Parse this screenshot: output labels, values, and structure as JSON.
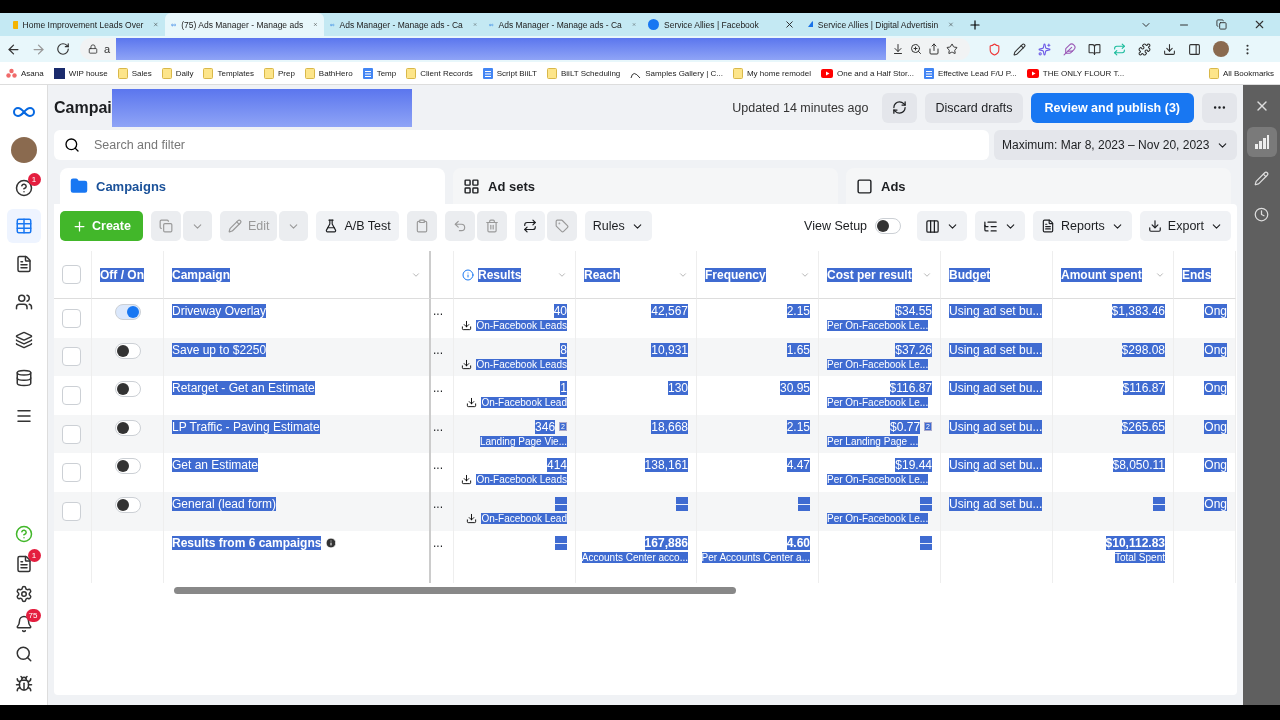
{
  "browser": {
    "tabs": [
      {
        "title": "Home Improvement Leads Over",
        "kind": "sheet",
        "selected": false
      },
      {
        "title": "(75) Ads Manager - Manage ads",
        "kind": "meta",
        "selected": true
      },
      {
        "title": "Ads Manager - Manage ads - Ca",
        "kind": "meta",
        "selected": false
      },
      {
        "title": "Ads Manager - Manage ads - Ca",
        "kind": "meta",
        "selected": false
      },
      {
        "title": "Service Allies | Facebook",
        "kind": "facebook",
        "selected": false
      },
      {
        "title": "Service Allies | Digital Advertisin",
        "kind": "site",
        "selected": false
      }
    ],
    "address": {
      "text": "a",
      "redacted": true
    },
    "bookmarks": [
      {
        "label": "Asana",
        "kind": "asana"
      },
      {
        "label": "WIP house",
        "kind": "logo"
      },
      {
        "label": "Sales",
        "kind": "folder"
      },
      {
        "label": "Daily",
        "kind": "folder"
      },
      {
        "label": "Templates",
        "kind": "folder"
      },
      {
        "label": "Prep",
        "kind": "folder"
      },
      {
        "label": "BathHero",
        "kind": "folder"
      },
      {
        "label": "Temp",
        "kind": "doc"
      },
      {
        "label": "Client Records",
        "kind": "folder"
      },
      {
        "label": "Script BiiLT",
        "kind": "doc"
      },
      {
        "label": "BiiLT Scheduling",
        "kind": "folder"
      },
      {
        "label": "Samples Gallery | C...",
        "kind": "arc"
      },
      {
        "label": "My home remodel",
        "kind": "folder"
      },
      {
        "label": "One and a Half Stor...",
        "kind": "video"
      },
      {
        "label": "Effective Lead F/U P...",
        "kind": "doc"
      },
      {
        "label": "THE ONLY FLOUR T...",
        "kind": "video"
      }
    ],
    "all_bookmarks": "All Bookmarks"
  },
  "nav_rail": {
    "items": [
      {
        "kind": "logo",
        "selected": false
      },
      {
        "kind": "avatar",
        "selected": false
      },
      {
        "kind": "alerts",
        "selected": false,
        "badge": "1"
      },
      {
        "kind": "table",
        "selected": true
      },
      {
        "kind": "pages",
        "selected": false
      },
      {
        "kind": "audience",
        "selected": false
      },
      {
        "kind": "catalog",
        "selected": false
      },
      {
        "kind": "database",
        "selected": false
      },
      {
        "kind": "menu",
        "selected": false
      }
    ],
    "bottom_items": [
      {
        "kind": "help",
        "selected": false
      },
      {
        "kind": "pages",
        "selected": false,
        "badge": "1"
      },
      {
        "kind": "settings",
        "selected": false
      },
      {
        "kind": "bell",
        "selected": false,
        "badge": "75"
      },
      {
        "kind": "search",
        "selected": false
      },
      {
        "kind": "bug",
        "selected": false
      }
    ]
  },
  "header": {
    "title": "Campai",
    "title_redacted": true,
    "updated": "Updated 14 minutes ago",
    "discard": "Discard drafts",
    "publish": "Review and publish (3)"
  },
  "search": {
    "placeholder": "Search and filter"
  },
  "date_range": "Maximum: Mar 8, 2023 – Nov 20, 2023",
  "level_tabs": [
    {
      "label": "Campaigns",
      "kind": "campaigns",
      "selected": true
    },
    {
      "label": "Ad sets",
      "kind": "adsets",
      "selected": false
    },
    {
      "label": "Ads",
      "kind": "ads",
      "selected": false
    }
  ],
  "toolbar": {
    "create": "Create",
    "edit": "Edit",
    "ab_test": "A/B Test",
    "rules": "Rules",
    "view_setup": {
      "label": "View Setup",
      "on": false
    },
    "reports": "Reports",
    "export": "Export"
  },
  "table": {
    "text_selected": true,
    "all_checked": false,
    "columns": [
      {
        "label": "Off / On",
        "sortable": false
      },
      {
        "label": "Campaign",
        "sortable": true
      },
      {
        "label": "Results",
        "sortable": true
      },
      {
        "label": "Reach",
        "sortable": true
      },
      {
        "label": "Frequency",
        "sortable": true
      },
      {
        "label": "Cost per result",
        "sortable": true
      },
      {
        "label": "Budget",
        "sortable": false
      },
      {
        "label": "Amount spent",
        "sortable": true
      },
      {
        "label": "Ends",
        "sortable": false
      }
    ],
    "rows": [
      {
        "checked": false,
        "on": true,
        "name": "Driveway Overlay",
        "delivery": "...",
        "results": {
          "value": "40",
          "label": "On-Facebook Leads",
          "download": true
        },
        "reach": "42,567",
        "frequency": "2.15",
        "cost": {
          "value": "$34.55",
          "label": "Per On-Facebook Le..."
        },
        "budget": "Using ad set bu...",
        "spent": "$1,383.46",
        "ends": "Ong"
      },
      {
        "checked": false,
        "on": false,
        "name": "Save up to $2250",
        "delivery": "...",
        "results": {
          "value": "8",
          "label": "On-Facebook Leads",
          "download": true
        },
        "reach": "10,931",
        "frequency": "1.65",
        "cost": {
          "value": "$37.26",
          "label": "Per On-Facebook Le..."
        },
        "budget": "Using ad set bu...",
        "spent": "$298.08",
        "ends": "Ong"
      },
      {
        "checked": false,
        "on": false,
        "name": "Retarget - Get an Estimate",
        "delivery": "...",
        "results": {
          "value": "1",
          "label": "On-Facebook Lead",
          "download": true
        },
        "reach": "130",
        "frequency": "30.95",
        "cost": {
          "value": "$116.87",
          "label": "Per On-Facebook Le..."
        },
        "budget": "Using ad set bu...",
        "spent": "$116.87",
        "ends": "Ong"
      },
      {
        "checked": false,
        "on": false,
        "name": "LP Traffic - Paving Estimate",
        "delivery": "...",
        "results": {
          "value": "346",
          "note": "2",
          "label": "Landing Page Vie...",
          "download": false
        },
        "reach": "18,668",
        "frequency": "2.15",
        "cost": {
          "value": "$0.77",
          "note": "2",
          "label": "Per Landing Page ..."
        },
        "budget": "Using ad set bu...",
        "spent": "$265.65",
        "ends": "Ong"
      },
      {
        "checked": false,
        "on": false,
        "name": "Get an Estimate",
        "delivery": "...",
        "results": {
          "value": "414",
          "label": "On-Facebook Leads",
          "download": true
        },
        "reach": "138,161",
        "frequency": "4.47",
        "cost": {
          "value": "$19.44",
          "label": "Per On-Facebook Le..."
        },
        "budget": "Using ad set bu...",
        "spent": "$8,050.11",
        "ends": "Ong"
      },
      {
        "checked": false,
        "on": false,
        "name": "General (lead form)",
        "delivery": "...",
        "results": {
          "value": "—",
          "label": "On-Facebook Lead",
          "download": true
        },
        "reach": "—",
        "frequency": "—",
        "cost": {
          "value": "—",
          "label": "Per On-Facebook Le..."
        },
        "budget": "Using ad set bu...",
        "spent": "—",
        "ends": "Ong"
      }
    ],
    "total": {
      "name": "Results from 6 campaigns",
      "delivery": "...",
      "results": "—",
      "reach": {
        "value": "167,886",
        "label": "Accounts Center acco..."
      },
      "frequency": {
        "value": "4.60",
        "label": "Per Accounts Center a..."
      },
      "cost": "—",
      "spent": {
        "value": "$10,112.83",
        "label": "Total Spent"
      }
    }
  },
  "right_rail": {
    "items": [
      {
        "kind": "close",
        "selected": false
      },
      {
        "kind": "chart",
        "selected": true
      },
      {
        "kind": "edit",
        "selected": false
      },
      {
        "kind": "history",
        "selected": false
      }
    ]
  }
}
